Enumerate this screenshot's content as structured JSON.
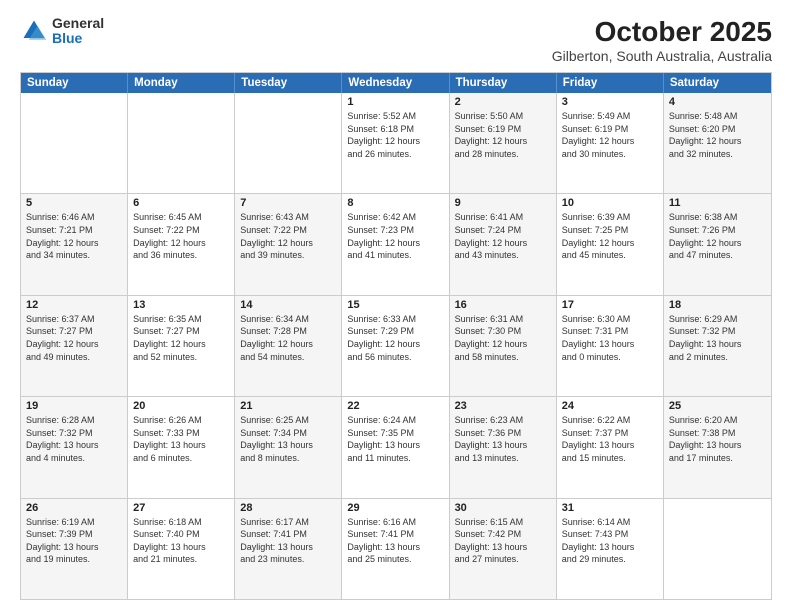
{
  "header": {
    "logo": {
      "general": "General",
      "blue": "Blue"
    },
    "title": "October 2025",
    "location": "Gilberton, South Australia, Australia"
  },
  "days_of_week": [
    "Sunday",
    "Monday",
    "Tuesday",
    "Wednesday",
    "Thursday",
    "Friday",
    "Saturday"
  ],
  "weeks": [
    [
      {
        "day": "",
        "info": ""
      },
      {
        "day": "",
        "info": ""
      },
      {
        "day": "",
        "info": ""
      },
      {
        "day": "1",
        "info": "Sunrise: 5:52 AM\nSunset: 6:18 PM\nDaylight: 12 hours\nand 26 minutes."
      },
      {
        "day": "2",
        "info": "Sunrise: 5:50 AM\nSunset: 6:19 PM\nDaylight: 12 hours\nand 28 minutes."
      },
      {
        "day": "3",
        "info": "Sunrise: 5:49 AM\nSunset: 6:19 PM\nDaylight: 12 hours\nand 30 minutes."
      },
      {
        "day": "4",
        "info": "Sunrise: 5:48 AM\nSunset: 6:20 PM\nDaylight: 12 hours\nand 32 minutes."
      }
    ],
    [
      {
        "day": "5",
        "info": "Sunrise: 6:46 AM\nSunset: 7:21 PM\nDaylight: 12 hours\nand 34 minutes."
      },
      {
        "day": "6",
        "info": "Sunrise: 6:45 AM\nSunset: 7:22 PM\nDaylight: 12 hours\nand 36 minutes."
      },
      {
        "day": "7",
        "info": "Sunrise: 6:43 AM\nSunset: 7:22 PM\nDaylight: 12 hours\nand 39 minutes."
      },
      {
        "day": "8",
        "info": "Sunrise: 6:42 AM\nSunset: 7:23 PM\nDaylight: 12 hours\nand 41 minutes."
      },
      {
        "day": "9",
        "info": "Sunrise: 6:41 AM\nSunset: 7:24 PM\nDaylight: 12 hours\nand 43 minutes."
      },
      {
        "day": "10",
        "info": "Sunrise: 6:39 AM\nSunset: 7:25 PM\nDaylight: 12 hours\nand 45 minutes."
      },
      {
        "day": "11",
        "info": "Sunrise: 6:38 AM\nSunset: 7:26 PM\nDaylight: 12 hours\nand 47 minutes."
      }
    ],
    [
      {
        "day": "12",
        "info": "Sunrise: 6:37 AM\nSunset: 7:27 PM\nDaylight: 12 hours\nand 49 minutes."
      },
      {
        "day": "13",
        "info": "Sunrise: 6:35 AM\nSunset: 7:27 PM\nDaylight: 12 hours\nand 52 minutes."
      },
      {
        "day": "14",
        "info": "Sunrise: 6:34 AM\nSunset: 7:28 PM\nDaylight: 12 hours\nand 54 minutes."
      },
      {
        "day": "15",
        "info": "Sunrise: 6:33 AM\nSunset: 7:29 PM\nDaylight: 12 hours\nand 56 minutes."
      },
      {
        "day": "16",
        "info": "Sunrise: 6:31 AM\nSunset: 7:30 PM\nDaylight: 12 hours\nand 58 minutes."
      },
      {
        "day": "17",
        "info": "Sunrise: 6:30 AM\nSunset: 7:31 PM\nDaylight: 13 hours\nand 0 minutes."
      },
      {
        "day": "18",
        "info": "Sunrise: 6:29 AM\nSunset: 7:32 PM\nDaylight: 13 hours\nand 2 minutes."
      }
    ],
    [
      {
        "day": "19",
        "info": "Sunrise: 6:28 AM\nSunset: 7:32 PM\nDaylight: 13 hours\nand 4 minutes."
      },
      {
        "day": "20",
        "info": "Sunrise: 6:26 AM\nSunset: 7:33 PM\nDaylight: 13 hours\nand 6 minutes."
      },
      {
        "day": "21",
        "info": "Sunrise: 6:25 AM\nSunset: 7:34 PM\nDaylight: 13 hours\nand 8 minutes."
      },
      {
        "day": "22",
        "info": "Sunrise: 6:24 AM\nSunset: 7:35 PM\nDaylight: 13 hours\nand 11 minutes."
      },
      {
        "day": "23",
        "info": "Sunrise: 6:23 AM\nSunset: 7:36 PM\nDaylight: 13 hours\nand 13 minutes."
      },
      {
        "day": "24",
        "info": "Sunrise: 6:22 AM\nSunset: 7:37 PM\nDaylight: 13 hours\nand 15 minutes."
      },
      {
        "day": "25",
        "info": "Sunrise: 6:20 AM\nSunset: 7:38 PM\nDaylight: 13 hours\nand 17 minutes."
      }
    ],
    [
      {
        "day": "26",
        "info": "Sunrise: 6:19 AM\nSunset: 7:39 PM\nDaylight: 13 hours\nand 19 minutes."
      },
      {
        "day": "27",
        "info": "Sunrise: 6:18 AM\nSunset: 7:40 PM\nDaylight: 13 hours\nand 21 minutes."
      },
      {
        "day": "28",
        "info": "Sunrise: 6:17 AM\nSunset: 7:41 PM\nDaylight: 13 hours\nand 23 minutes."
      },
      {
        "day": "29",
        "info": "Sunrise: 6:16 AM\nSunset: 7:41 PM\nDaylight: 13 hours\nand 25 minutes."
      },
      {
        "day": "30",
        "info": "Sunrise: 6:15 AM\nSunset: 7:42 PM\nDaylight: 13 hours\nand 27 minutes."
      },
      {
        "day": "31",
        "info": "Sunrise: 6:14 AM\nSunset: 7:43 PM\nDaylight: 13 hours\nand 29 minutes."
      },
      {
        "day": "",
        "info": ""
      }
    ]
  ]
}
